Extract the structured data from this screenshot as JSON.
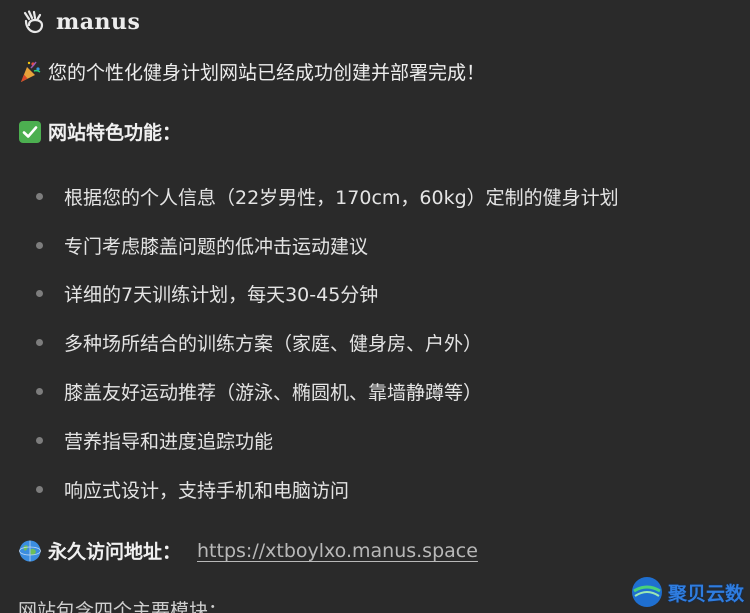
{
  "header": {
    "brand": "manus",
    "logo_icon": "manus-hand-logo-icon"
  },
  "message": {
    "success_emoji": "party-popper-icon",
    "success_text": "您的个性化健身计划网站已经成功创建并部署完成！",
    "features_emoji": "check-mark-icon",
    "features_heading": "网站特色功能：",
    "features": [
      "根据您的个人信息（22岁男性，170cm，60kg）定制的健身计划",
      "专门考虑膝盖问题的低冲击运动建议",
      "详细的7天训练计划，每天30-45分钟",
      "多种场所结合的训练方案（家庭、健身房、户外）",
      "膝盖友好运动推荐（游泳、椭圆机、靠墙静蹲等）",
      "营养指导和进度追踪功能",
      "响应式设计，支持手机和电脑访问"
    ],
    "url_emoji": "globe-icon",
    "url_label": "永久访问地址：",
    "url": "https://xtboylxo.manus.space",
    "cut_text": "网站包含四个主要模块："
  },
  "watermark": {
    "text": "聚贝云数"
  },
  "colors": {
    "background": "#2a2a2a",
    "text": "#e6e6e6",
    "link": "#b8b8b8",
    "check_green": "#4caf50",
    "watermark_blue": "#2f7de0"
  }
}
